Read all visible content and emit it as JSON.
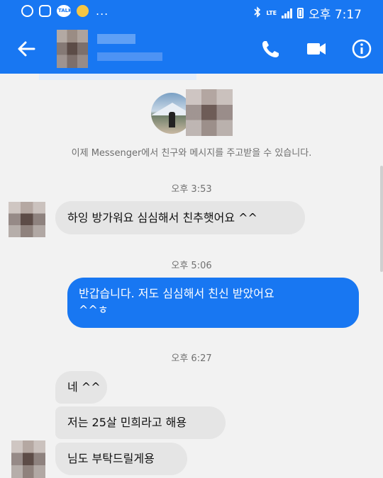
{
  "status_bar": {
    "time": "오후 7:17",
    "network": "LTE",
    "notification_icons": [
      "u-app-icon",
      "instagram-icon",
      "kakaotalk-icon",
      "kakao-face-icon"
    ],
    "talk_label": "TALK",
    "more": "...",
    "colors": {
      "bar": "#1877f2"
    }
  },
  "header": {
    "contact_name_visible": false,
    "actions": [
      "phone-icon",
      "video-camera-icon",
      "info-icon"
    ]
  },
  "chat": {
    "intro": "이제 Messenger에서 친구와 메시지를 주고받을 수 있습니다.",
    "timestamps": [
      "오후 3:53",
      "오후 5:06",
      "오후 6:27"
    ],
    "messages": [
      {
        "side": "in",
        "text": "하잉 방가워요 심심해서 친추햇어요 ^^"
      },
      {
        "side": "out",
        "line1": "반갑습니다. 저도 심심해서 친신 받았어요",
        "line2": "^^ㅎ"
      },
      {
        "side": "in",
        "text": "네 ^^"
      },
      {
        "side": "in",
        "text": "저는 25살 민희라고 해용"
      },
      {
        "side": "in",
        "text": "님도 부탁드릴게용"
      }
    ],
    "colors": {
      "outgoing": "#1877f2",
      "incoming": "#e5e5e5",
      "background": "#f2f2f2"
    }
  }
}
